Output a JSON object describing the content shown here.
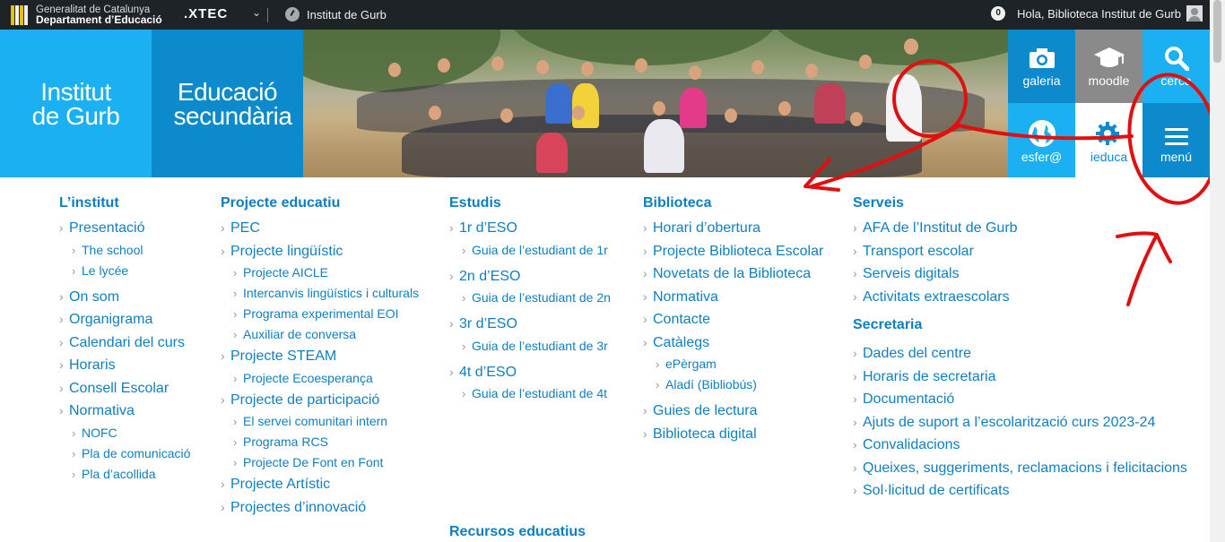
{
  "adminbar": {
    "gencat_line1": "Generalitat de Catalunya",
    "gencat_line2": "Departament d’Educació",
    "xtec": ".XTEC",
    "site_name": "Institut de Gurb",
    "notifications": "0",
    "greeting": "Hola, Biblioteca Institut de Gurb"
  },
  "header": {
    "school_name": "Institut de Gurb",
    "school_type": "Educació secundària",
    "tiles": {
      "galeria": "galeria",
      "moodle": "moodle",
      "cerca": "cerca",
      "esfera": "esfer@",
      "ieduca": "ieduca",
      "menu": "menú"
    }
  },
  "menu": {
    "institut": {
      "title": "L’institut",
      "presentacio": "Presentació",
      "school": "The school",
      "lycee": "Le lycée",
      "onsom": "On som",
      "organigrama": "Organigrama",
      "calendari": "Calendari del curs",
      "horaris": "Horaris",
      "consell": "Consell Escolar",
      "normativa": "Normativa",
      "nofc": "NOFC",
      "pla_comunicacio": "Pla de comunicació",
      "pla_acollida": "Pla d’acollida"
    },
    "projecte": {
      "title": "Projecte educatiu",
      "pec": "PEC",
      "linguistic": "Projecte lingüístic",
      "aicle": "Projecte AICLE",
      "intercanvis": "Intercanvis lingüístics i culturals",
      "eoi": "Programa experimental EOI",
      "auxiliar": "Auxiliar de conversa",
      "steam": "Projecte STEAM",
      "ecoesperanca": "Projecte Ecoesperança",
      "participacio": "Projecte de participació",
      "comunitari": "El servei comunitari intern",
      "rcs": "Programa RCS",
      "defont": "Projecte De Font en Font",
      "artistic": "Projecte Artístic",
      "innovacio": "Projectes d’innovació"
    },
    "estudis": {
      "title": "Estudis",
      "eso1": "1r d’ESO",
      "guia1": "Guia de l’estudiant de 1r",
      "eso2": "2n d’ESO",
      "guia2": "Guia de l’estudiant de 2n",
      "eso3": "3r d’ESO",
      "guia3": "Guia de l’estudiant de 3r",
      "eso4": "4t d’ESO",
      "guia4": "Guia de l’estudiant de 4t",
      "recursos": "Recursos educatius"
    },
    "biblioteca": {
      "title": "Biblioteca",
      "horari": "Horari d’obertura",
      "projecte": "Projecte Biblioteca Escolar",
      "novetats": "Novetats de la Biblioteca",
      "normativa": "Normativa",
      "contacte": "Contacte",
      "catalegs": "Catàlegs",
      "epergam": "ePèrgam",
      "aladi": "Aladí (Bibliobús)",
      "guies": "Guies de lectura",
      "digital": "Biblioteca digital"
    },
    "serveis": {
      "title": "Serveis",
      "afa": "AFA de l’Institut de Gurb",
      "transport": "Transport escolar",
      "digitals": "Serveis digitals",
      "extraescolars": "Activitats extraescolars"
    },
    "secretaria": {
      "title": "Secretaria",
      "dades": "Dades del centre",
      "horaris": "Horaris de secretaria",
      "documentacio": "Documentació",
      "ajuts": "Ajuts de suport a l’escolarització curs 2023-24",
      "convalidacions": "Convalidacions",
      "queixes": "Queixes, suggeriments, reclamacions i felicitacions",
      "certificats": "Sol·licitud de certificats"
    }
  },
  "colors": {
    "accent_light": "#1ab0f2",
    "accent_dark": "#0d8acb",
    "link": "#0f7fbf",
    "annotation": "#e01010"
  }
}
